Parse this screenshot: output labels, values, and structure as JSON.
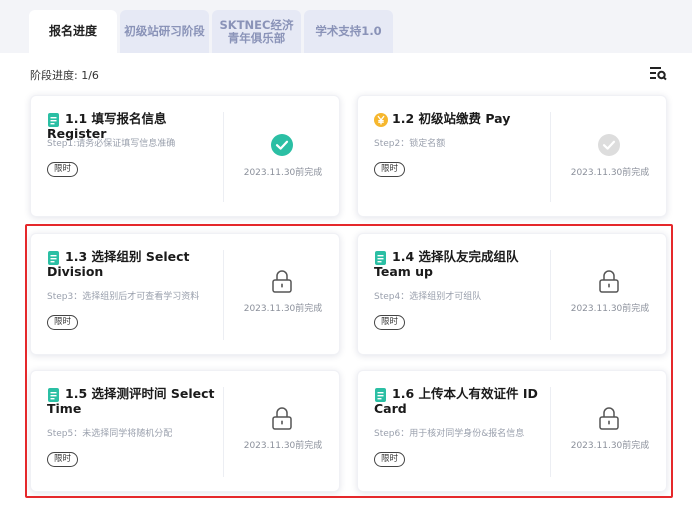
{
  "tabs": [
    {
      "label": "报名进度"
    },
    {
      "label": "初级站研习阶段"
    },
    {
      "label_line1": "SKTNEC经济",
      "label_line2": "青年俱乐部"
    },
    {
      "label": "学术支持1.0"
    }
  ],
  "progress": {
    "label": "阶段进度: 1/6"
  },
  "cards": [
    {
      "title": "1.1 填写报名信息 Register",
      "desc": "Step1:请务必保证填写信息准确",
      "badge": "限时",
      "deadline": "2023.11.30前完成",
      "status": "completed",
      "icon": "document-green-icon"
    },
    {
      "title": "1.2 初级站缴费 Pay",
      "desc": "Step2：锁定名额",
      "badge": "限时",
      "deadline": "2023.11.30前完成",
      "status": "pending",
      "icon": "yen-coin-icon"
    },
    {
      "title": "1.3 选择组别 Select Division",
      "desc": "Step3：选择组别后才可查看学习资料",
      "badge": "限时",
      "deadline": "2023.11.30前完成",
      "status": "locked",
      "icon": "document-green-icon"
    },
    {
      "title": "1.4 选择队友完成组队 Team up",
      "desc": "Step4：选择组别才可组队",
      "badge": "限时",
      "deadline": "2023.11.30前完成",
      "status": "locked",
      "icon": "document-green-icon"
    },
    {
      "title": "1.5 选择测评时间 Select Time",
      "desc": "Step5：未选择同学将随机分配",
      "badge": "限时",
      "deadline": "2023.11.30前完成",
      "status": "locked",
      "icon": "document-green-icon"
    },
    {
      "title": "1.6 上传本人有效证件 ID Card",
      "desc": "Step6：用于核对同学身份&报名信息",
      "badge": "限时",
      "deadline": "2023.11.30前完成",
      "status": "locked",
      "icon": "document-green-icon"
    }
  ],
  "colors": {
    "accent": "#2bbfa4",
    "highlight": "#e5282b",
    "tab_inactive": "#8a93b8"
  }
}
